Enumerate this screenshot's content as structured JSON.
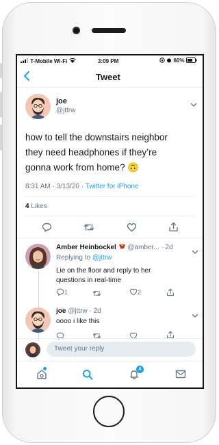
{
  "status_bar": {
    "carrier": "T-Mobile Wi-Fi",
    "time": "3:09 PM",
    "battery": "60%"
  },
  "header": {
    "title": "Tweet",
    "back_icon": "chevron-left-icon"
  },
  "tweet": {
    "name": "joe",
    "handle": "@jttrw",
    "text_lines": [
      "how to tell the downstairs neighbor",
      "they need headphones if they’re",
      "gonna work from home? 🙃"
    ],
    "time": "8:31 AM",
    "date_sep": " · ",
    "date": "3/13/20",
    "via_sep": " · ",
    "source": "Twitter for iPhone",
    "likes_count": "4",
    "likes_label": " Likes"
  },
  "replies": [
    {
      "name": "Amber Heinbockel",
      "handle": "@amber...",
      "age": "· 2d",
      "replying_prefix": "Replying to ",
      "replying_to": "@jttrw",
      "text_lines": [
        "Lie on the floor and reply to her",
        "questions in real-time"
      ],
      "reply_count": "1",
      "like_count": "2"
    },
    {
      "name": "joe",
      "handle": "@jttrw",
      "age": "· 2d",
      "text": "oooo i like this"
    }
  ],
  "composer": {
    "placeholder": "Tweet your reply"
  },
  "tab_bar": {
    "notifications_badge": "4",
    "items": [
      "home-icon",
      "search-icon",
      "notifications-icon",
      "messages-icon"
    ]
  },
  "colors": {
    "accent": "#1da1f2",
    "muted": "#657786",
    "text": "#14171a"
  }
}
